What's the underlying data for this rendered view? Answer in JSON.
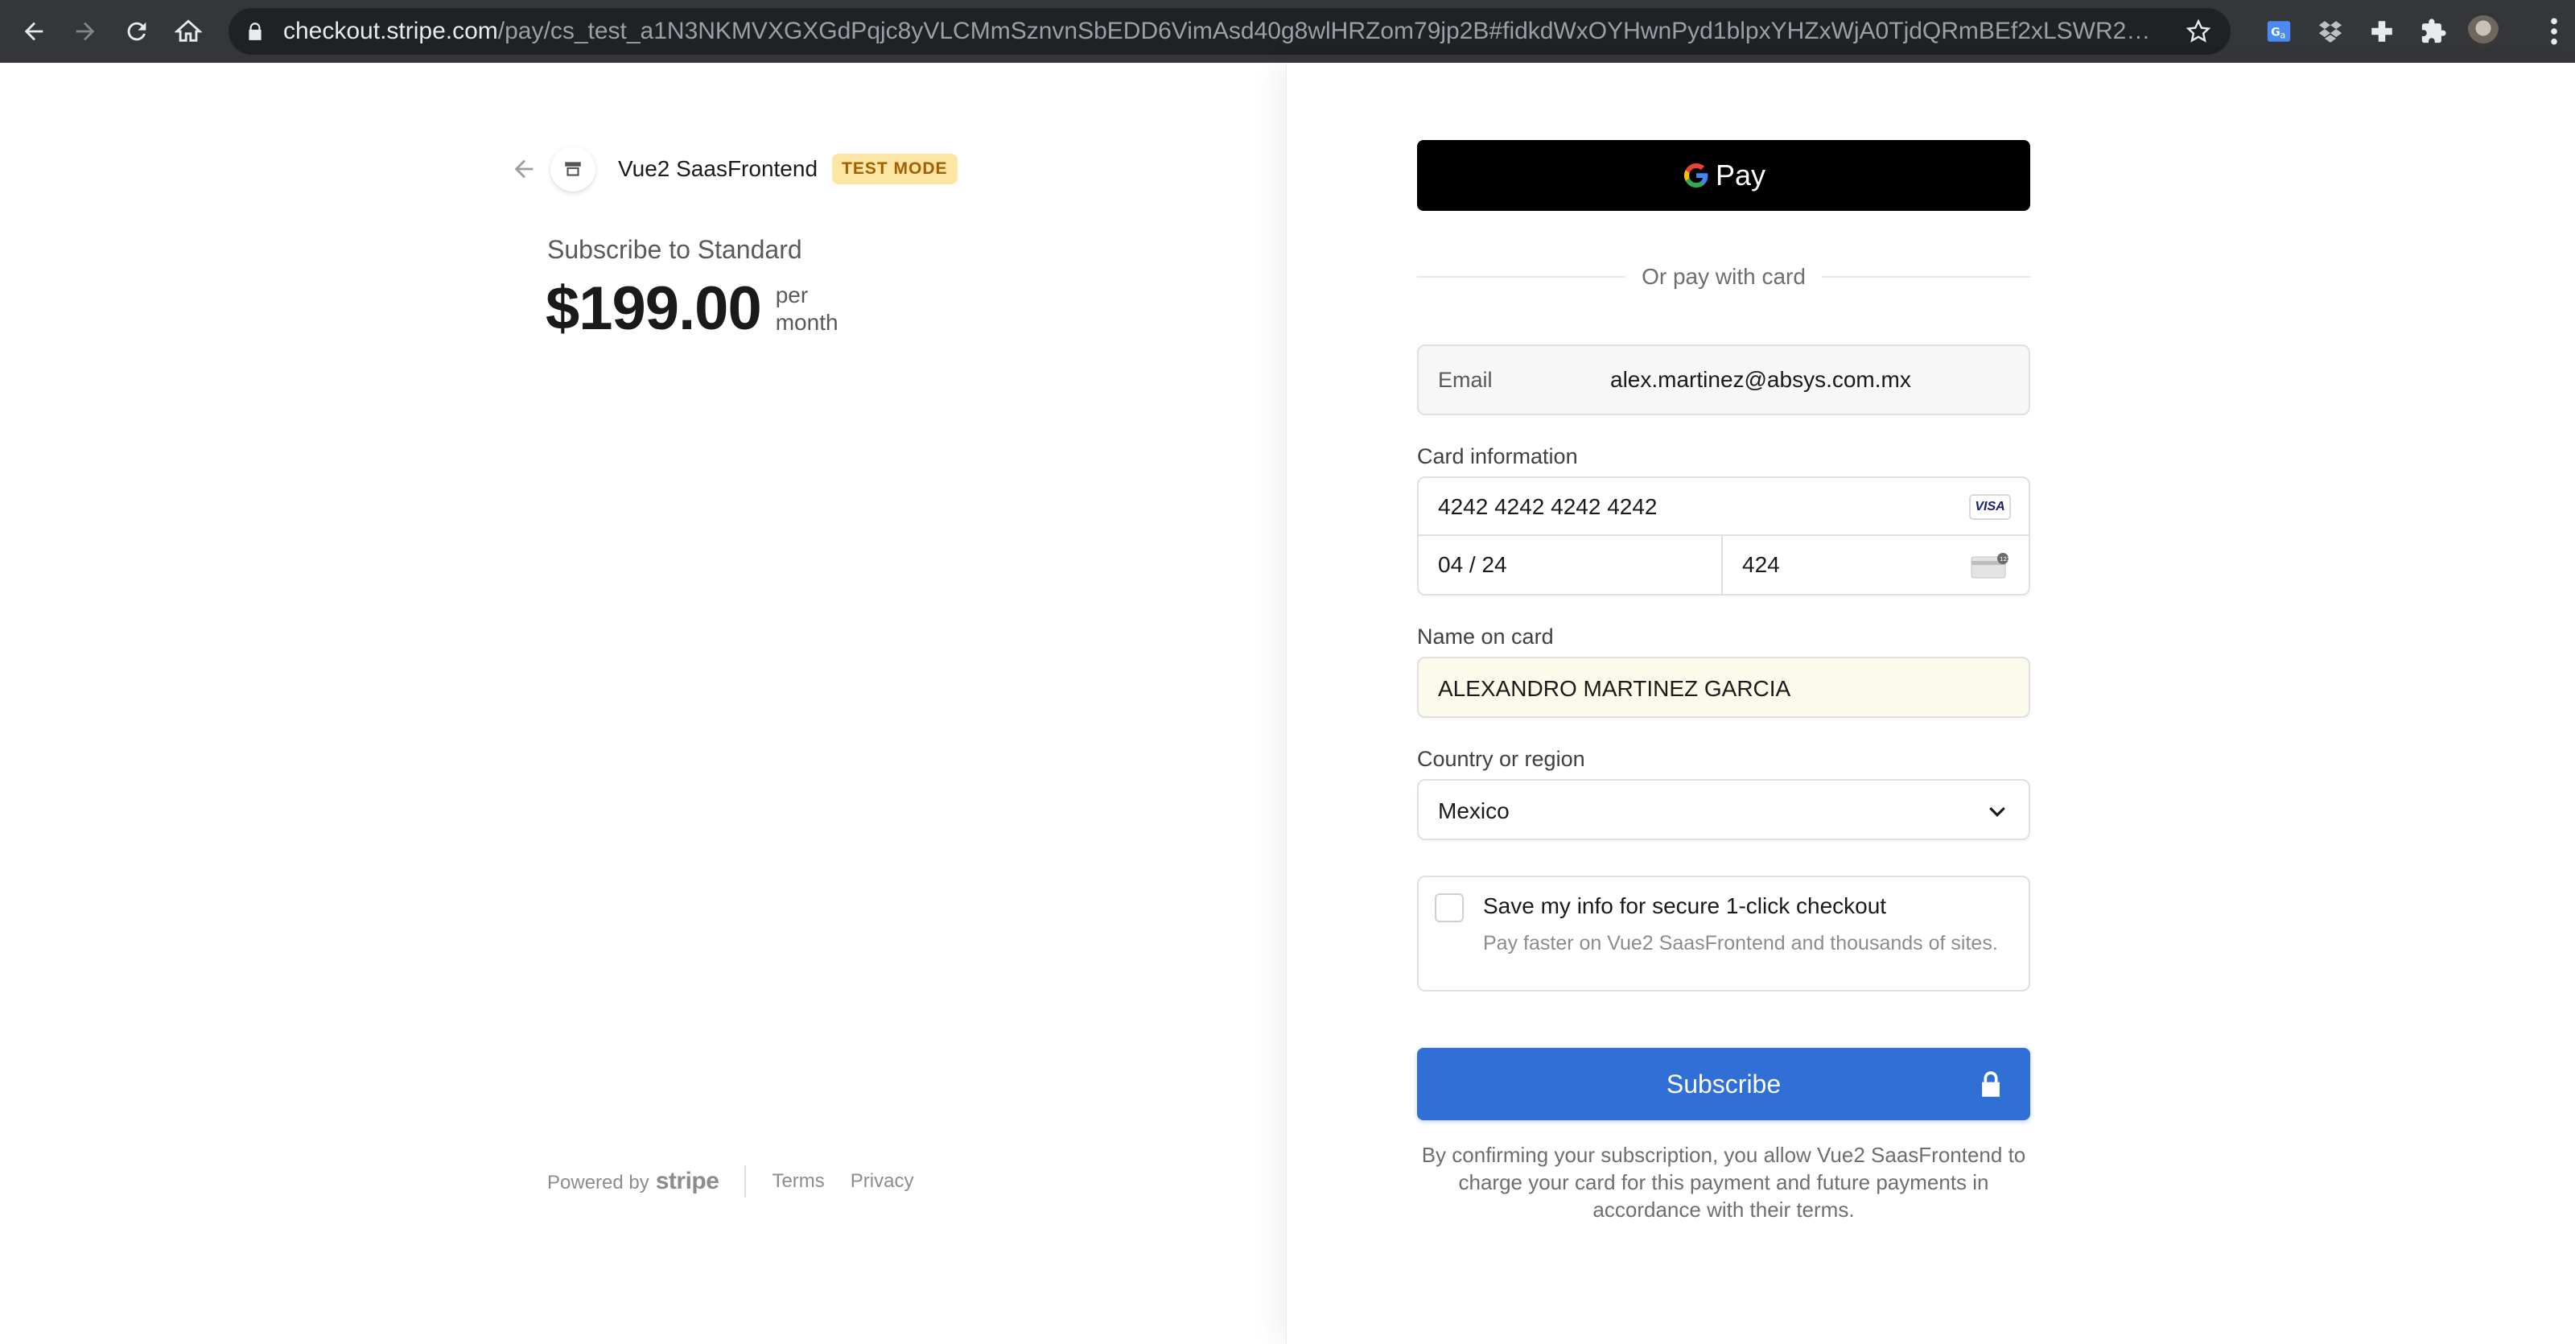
{
  "browser": {
    "url_host": "checkout.stripe.com",
    "url_path": "/pay/cs_test_a1N3NKMVXGXGdPqjc8yVLCMmSznvnSbEDD6VimAsd40g8wlHRZom79jp2B#fidkdWxOYHwnPyd1blpxYHZxWjA0TjdQRmBEf2xLSWR2PFNfXV..."
  },
  "merchant": {
    "name": "Vue2 SaasFrontend",
    "badge": "TEST MODE"
  },
  "summary": {
    "subscribe_label": "Subscribe to Standard",
    "price": "$199.00",
    "unit_line1": "per",
    "unit_line2": "month"
  },
  "footer": {
    "powered_by": "Powered by",
    "brand": "stripe",
    "terms": "Terms",
    "privacy": "Privacy"
  },
  "payment": {
    "gpay_label": "Pay",
    "divider_text": "Or pay with card",
    "email_label": "Email",
    "email_value": "alex.martinez@absys.com.mx",
    "card_label": "Card information",
    "card_number": "4242 4242 4242 4242",
    "card_brand": "VISA",
    "card_expiry": "04 / 24",
    "card_cvc": "424",
    "name_label": "Name on card",
    "name_value": "ALEXANDRO MARTINEZ GARCIA",
    "country_label": "Country or region",
    "country_value": "Mexico",
    "save_title": "Save my info for secure 1-click checkout",
    "save_sub": "Pay faster on Vue2 SaasFrontend and thousands of sites.",
    "subscribe_button": "Subscribe",
    "terms_text": "By confirming your subscription, you allow Vue2 SaasFrontend to charge your card for this payment and future payments in accordance with their terms."
  },
  "colors": {
    "accent": "#2f6fd6",
    "badge_bg": "#fde5a4",
    "badge_text": "#a35f00",
    "autofill_bg": "#fcfaea"
  }
}
